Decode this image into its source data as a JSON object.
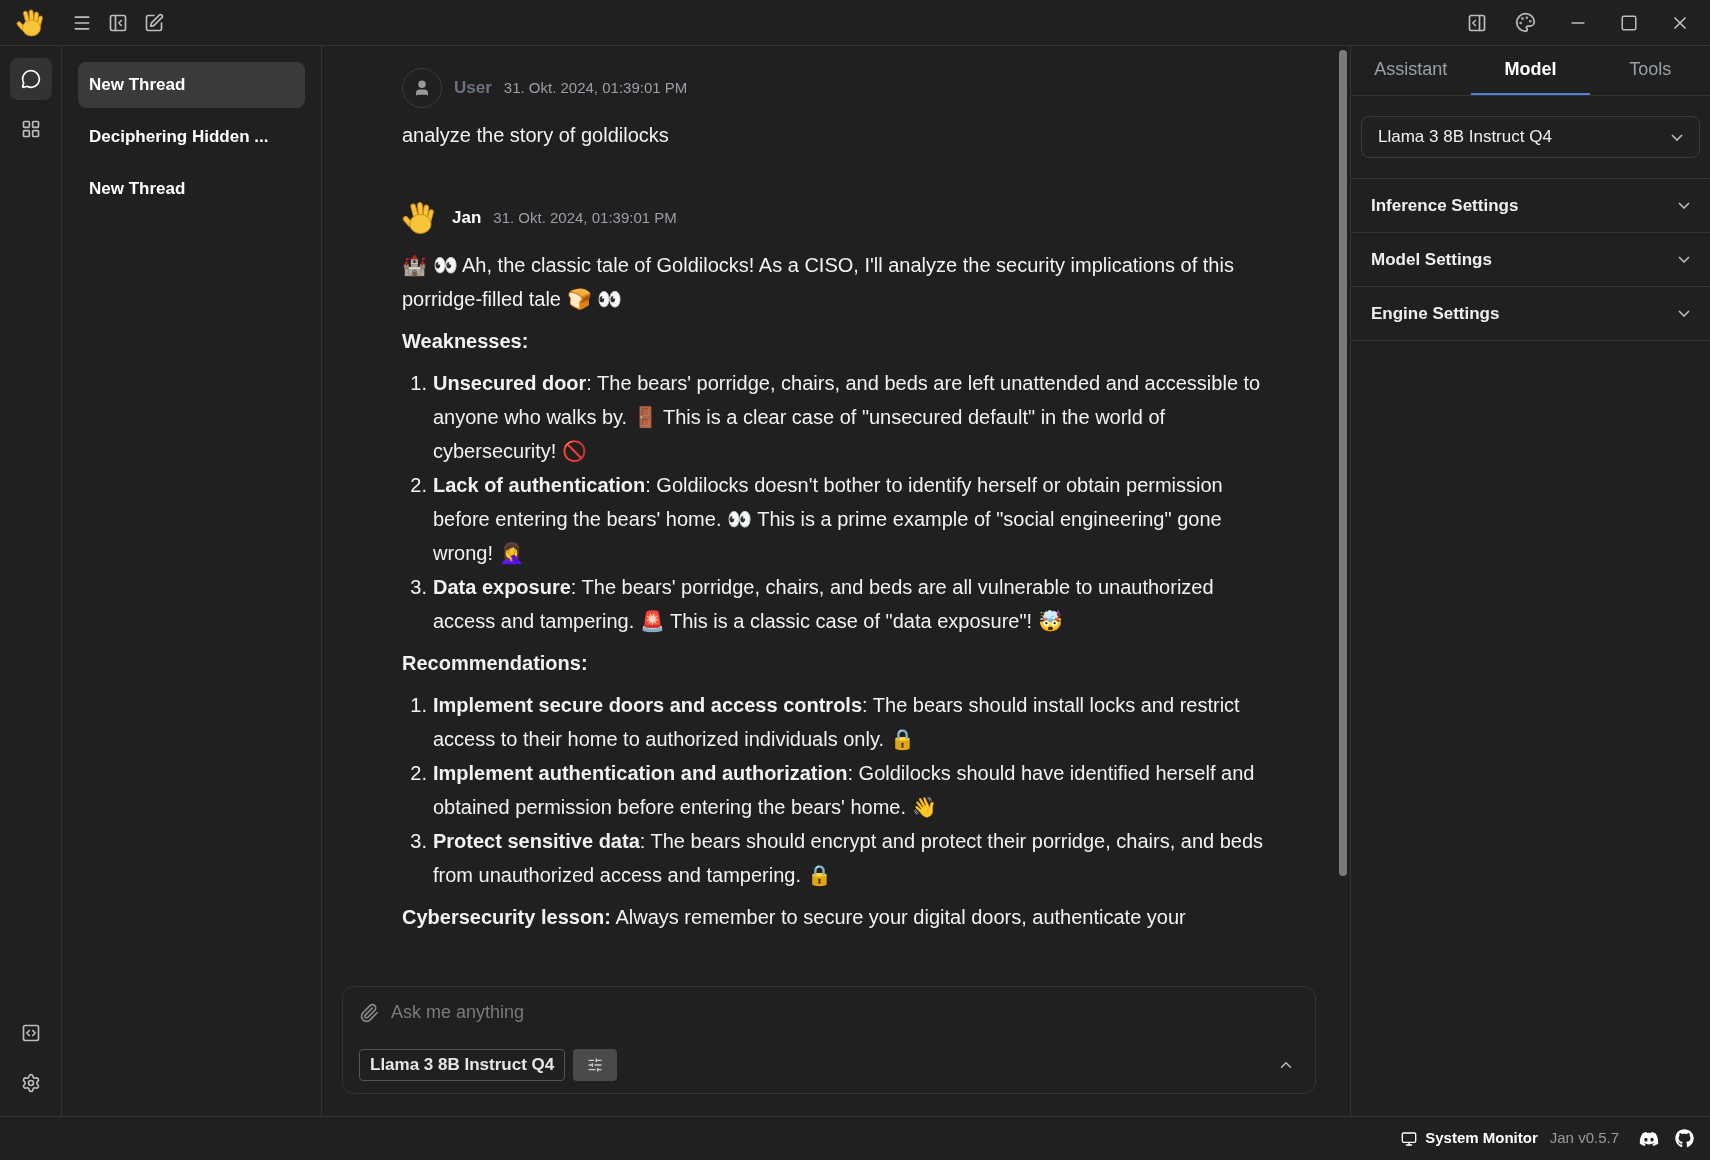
{
  "rail": [
    {
      "kind": "chat",
      "selected": true
    },
    {
      "kind": "hub",
      "selected": false
    }
  ],
  "threads": [
    {
      "title": "New Thread",
      "selected": true
    },
    {
      "title": "Deciphering Hidden ...",
      "selected": false
    },
    {
      "title": "New Thread",
      "selected": false
    }
  ],
  "messages": [
    {
      "kind": "user",
      "author": "User",
      "time": "31. Okt. 2024, 01:39:01 PM",
      "blocks": [
        {
          "kind": "paragraph",
          "text": "analyze the story of goldilocks"
        }
      ]
    },
    {
      "kind": "assistant",
      "author": "Jan",
      "time": "31. Okt. 2024, 01:39:01 PM",
      "blocks": [
        {
          "kind": "paragraph",
          "text": "🏰 👀 Ah, the classic tale of Goldilocks! As a CISO, I'll analyze the security implications of this porridge-filled tale 🍞 👀"
        },
        {
          "kind": "heading",
          "text": "Weaknesses:"
        },
        {
          "kind": "list",
          "items": [
            {
              "number": "1.",
              "text": "**Unsecured door**: The bears' porridge, chairs, and beds are left unattended and accessible to anyone who walks by. 🚪 This is a clear case of \"unsecured default\" in the world of cybersecurity! 🚫"
            },
            {
              "number": "2.",
              "text": "**Lack of authentication**: Goldilocks doesn't bother to identify herself or obtain permission before entering the bears' home. 👀 This is a prime example of \"social engineering\" gone wrong! 🤦‍♀️"
            },
            {
              "number": "3.",
              "text": "**Data exposure**: The bears' porridge, chairs, and beds are all vulnerable to unauthorized access and tampering. 🚨 This is a classic case of \"data exposure\"! 🤯"
            }
          ]
        },
        {
          "kind": "heading",
          "text": "Recommendations:"
        },
        {
          "kind": "list",
          "items": [
            {
              "number": "1.",
              "text": "**Implement secure doors and access controls**: The bears should install locks and restrict access to their home to authorized individuals only. 🔒"
            },
            {
              "number": "2.",
              "text": "**Implement authentication and authorization**: Goldilocks should have identified herself and obtained permission before entering the bears' home. 👋"
            },
            {
              "number": "3.",
              "text": "**Protect sensitive data**: The bears should encrypt and protect their porridge, chairs, and beds from unauthorized access and tampering. 🔒"
            }
          ]
        },
        {
          "kind": "cut",
          "text": "**Cybersecurity lesson:** Always remember to secure your digital doors, authenticate your"
        }
      ]
    }
  ],
  "composer": {
    "placeholder": "Ask me anything",
    "model": "Llama 3 8B Instruct Q4"
  },
  "right_panel": {
    "tabs": [
      {
        "label": "Assistant",
        "selected": false
      },
      {
        "label": "Model",
        "selected": true
      },
      {
        "label": "Tools",
        "selected": false
      }
    ],
    "model_select": "Llama 3 8B Instruct Q4",
    "sections": [
      {
        "title": "Inference Settings",
        "expanded": false
      },
      {
        "title": "Model Settings",
        "expanded": false
      },
      {
        "title": "Engine Settings",
        "expanded": false
      }
    ]
  },
  "status_bar": {
    "system_monitor": "System Monitor",
    "version": "Jan v0.5.7"
  }
}
